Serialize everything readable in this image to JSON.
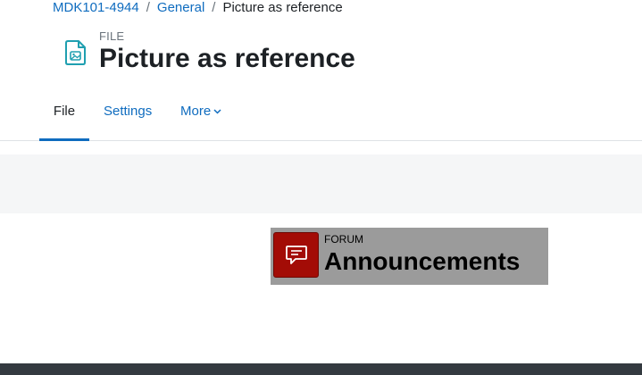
{
  "breadcrumb": {
    "course": "MDK101-4944",
    "section": "General",
    "current": "Picture as reference",
    "separator": "/"
  },
  "header": {
    "icon": "file-image-icon",
    "label": "FILE",
    "title": "Picture as reference"
  },
  "tabs": [
    {
      "label": "File",
      "active": true
    },
    {
      "label": "Settings",
      "active": false
    },
    {
      "label": "More",
      "active": false,
      "icon": "chevron-down-icon"
    }
  ],
  "activity": {
    "icon": "forum-icon",
    "label": "FORUM",
    "title": "Announcements"
  },
  "colors": {
    "link": "#0f6cbf",
    "text": "#1d2125",
    "forum_icon_bg": "#a30c06",
    "card_bg": "#9b9b9b",
    "footer": "#343a40"
  }
}
